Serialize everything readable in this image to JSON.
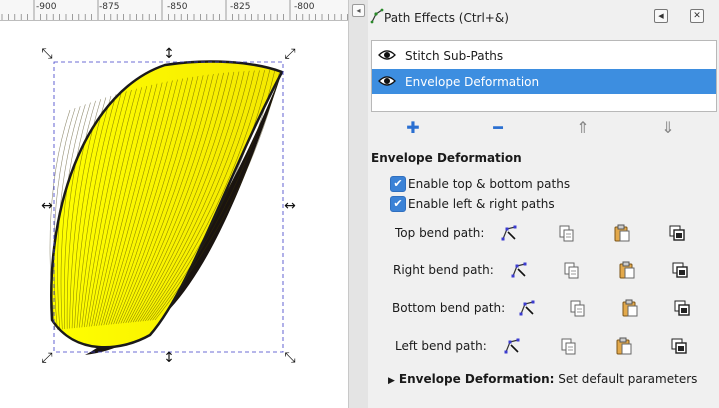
{
  "ruler": {
    "labels": [
      "-900",
      "-875",
      "-850",
      "-825",
      "-800"
    ]
  },
  "canvas": {
    "fill_color": "#ffff00",
    "stroke_color": "#1a1a1a",
    "selection_color": "#3c3cc8"
  },
  "panel": {
    "title": "Path Effects (Ctrl+&)",
    "float_icon": "float-panel-icon",
    "close_icon": "close-icon",
    "effects": [
      {
        "label": "Stitch Sub-Paths",
        "selected": false,
        "icon": "eye-icon"
      },
      {
        "label": "Envelope Deformation",
        "selected": true,
        "icon": "eye-icon"
      }
    ],
    "toolbar": {
      "add": "plus-icon",
      "remove": "minus-icon",
      "up": "raise-icon",
      "down": "lower-icon"
    },
    "section_title": "Envelope Deformation",
    "checkboxes": [
      {
        "label": "Enable top & bottom paths",
        "checked": true
      },
      {
        "label": "Enable left & right paths",
        "checked": true
      }
    ],
    "bend_paths": [
      {
        "label": "Top bend path:"
      },
      {
        "label": "Right bend path:"
      },
      {
        "label": "Bottom bend path:"
      },
      {
        "label": "Left bend path:"
      }
    ],
    "bend_icons": [
      "edit-path-icon",
      "copy-path-icon",
      "paste-path-icon",
      "link-path-icon"
    ],
    "footer": {
      "bold": "Envelope Deformation:",
      "text": " Set default parameters"
    },
    "accent_color": "#3d8ee0"
  }
}
